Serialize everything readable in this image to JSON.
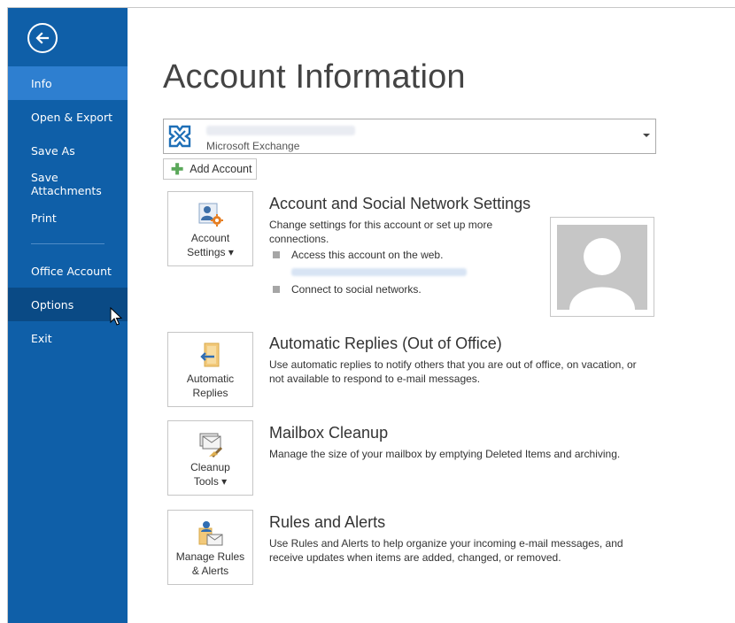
{
  "sidebar": {
    "items": [
      {
        "label": "Info"
      },
      {
        "label": "Open & Export"
      },
      {
        "label": "Save As"
      },
      {
        "label": "Save Attachments"
      },
      {
        "label": "Print"
      },
      {
        "label": "Office Account"
      },
      {
        "label": "Options"
      },
      {
        "label": "Exit"
      }
    ],
    "active_item": "Info",
    "hovered_item": "Options",
    "bg_color": "#0f5fa8",
    "active_color": "#2e7fd0"
  },
  "page": {
    "title": "Account Information"
  },
  "account": {
    "type": "Microsoft Exchange",
    "email": "",
    "add_account_label": "Add Account"
  },
  "sections": {
    "account_settings": {
      "tile_label_1": "Account",
      "tile_label_2": "Settings ▾",
      "title": "Account and Social Network Settings",
      "description": "Change settings for this account or set up more connections.",
      "bullet_1": "Access this account on the web.",
      "bullet_2": "Connect to social networks."
    },
    "automatic_replies": {
      "tile_label_1": "Automatic",
      "tile_label_2": "Replies",
      "title": "Automatic Replies (Out of Office)",
      "description": "Use automatic replies to notify others that you are out of office, on vacation, or not available to respond to e-mail messages."
    },
    "mailbox_cleanup": {
      "tile_label_1": "Cleanup",
      "tile_label_2": "Tools ▾",
      "title": "Mailbox Cleanup",
      "description": "Manage the size of your mailbox by emptying Deleted Items and archiving."
    },
    "rules_alerts": {
      "tile_label_1": "Manage Rules",
      "tile_label_2": "& Alerts",
      "title": "Rules and Alerts",
      "description": "Use Rules and Alerts to help organize your incoming e-mail messages, and receive updates when items are added, changed, or removed."
    }
  },
  "icons": {
    "back": "back-arrow-icon",
    "exchange": "exchange-icon",
    "add": "plus-icon",
    "account_settings": "account-settings-icon",
    "automatic_replies": "automatic-replies-icon",
    "cleanup": "cleanup-tools-icon",
    "rules": "rules-alerts-icon",
    "profile": "profile-photo-placeholder-icon"
  }
}
